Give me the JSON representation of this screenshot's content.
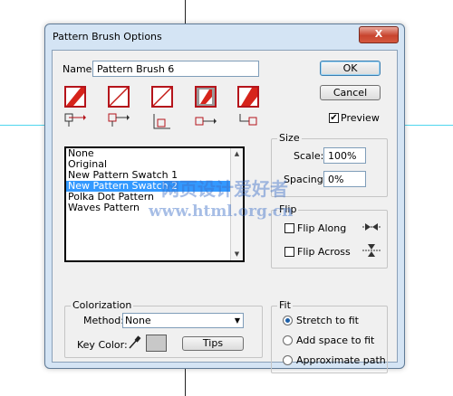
{
  "window": {
    "title": "Pattern Brush Options",
    "close_label": "X"
  },
  "name_field": {
    "label": "Name:",
    "value": "Pattern Brush 6"
  },
  "buttons": {
    "ok": "OK",
    "cancel": "Cancel",
    "tips": "Tips"
  },
  "preview": {
    "label": "Preview",
    "checked": true
  },
  "pattern_list": {
    "items": [
      "None",
      "Original",
      "New Pattern Swatch 1",
      "New Pattern Swatch 2",
      "Polka Dot Pattern",
      "Waves Pattern"
    ],
    "selected_index": 3
  },
  "size": {
    "group_label": "Size",
    "scale_label": "Scale:",
    "scale_value": "100%",
    "spacing_label": "Spacing:",
    "spacing_value": "0%"
  },
  "flip": {
    "group_label": "Flip",
    "along_label": "Flip Along",
    "across_label": "Flip Across"
  },
  "colorization": {
    "group_label": "Colorization",
    "method_label": "Method:",
    "method_value": "None",
    "key_color_label": "Key Color:"
  },
  "fit": {
    "group_label": "Fit",
    "options": [
      "Stretch to fit",
      "Add space to fit",
      "Approximate path"
    ],
    "selected_index": 0
  },
  "watermark": {
    "line1": "网页设计爱好者",
    "line2": "www.html.org.cn"
  },
  "colors": {
    "accent_red": "#b5141b",
    "selection_blue": "#3399ff",
    "guide_cyan": "#4fd6ee"
  }
}
